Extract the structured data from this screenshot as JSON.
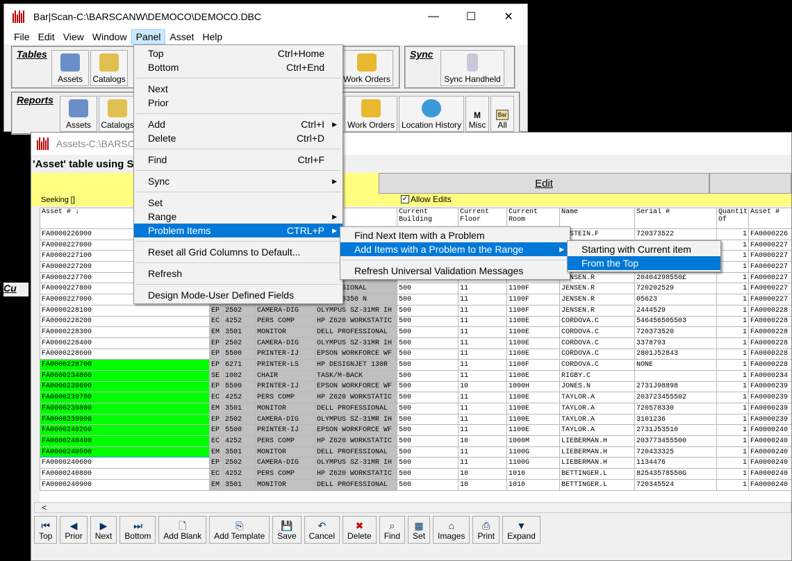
{
  "main_window": {
    "title": "Bar|Scan-C:\\BARSCANW\\DEMOCO\\DEMOCO.DBC",
    "controls": [
      "—",
      "☐",
      "✕"
    ],
    "menubar": [
      "File",
      "Edit",
      "View",
      "Window",
      "Panel",
      "Asset",
      "Help"
    ],
    "tables_group": {
      "label": "Tables",
      "buttons": [
        "Assets",
        "Catalogs",
        "Work Orders"
      ]
    },
    "sync_group": {
      "label": "Sync",
      "buttons": [
        "Sync Handheld"
      ]
    },
    "reports_group": {
      "label": "Reports",
      "buttons": [
        "Assets",
        "Catalogs",
        "Work Orders",
        "Location History",
        "Misc",
        "All"
      ]
    },
    "misc_letter": "M",
    "all_letters": "Bar",
    "cut_label": "Cu"
  },
  "assets_window": {
    "title": "Assets-C:\\BARSCAN",
    "subtitle": "'Asset' table using Se",
    "tab_edit": "Edit",
    "seeking_label": "Seeking []",
    "allow_edits_label": "Allow Edits",
    "columns": [
      "Asset #",
      "",
      "",
      "",
      "g\nation",
      "Current\nBuilding",
      "Current\nFloor",
      "Current\nRoom",
      "Name",
      "Serial #",
      "Quantit\nOf",
      "Asset #"
    ],
    "rows": [
      [
        "FA0000226900",
        "",
        "",
        "",
        "",
        "",
        "",
        "",
        "RNSTEIN.F",
        "720373522",
        "1",
        "FA0000226"
      ],
      [
        "FA0000227000",
        "",
        "",
        "",
        "",
        "",
        "",
        "",
        "",
        "",
        "1",
        "FA0000227"
      ],
      [
        "FA0000227100",
        "",
        "",
        "",
        "",
        "",
        "",
        "",
        "",
        "",
        "1",
        "FA0000227"
      ],
      [
        "FA0000227200",
        "",
        "",
        "",
        "",
        "",
        "",
        "",
        "",
        "",
        "1",
        "FA0000227"
      ],
      [
        "FA0000227700",
        "",
        "",
        "",
        "WORKSTATIC",
        "500",
        "11",
        "1100F",
        "JENSEN.R",
        "20404298550£",
        "1",
        "FA0000227"
      ],
      [
        "FA0000227800",
        "",
        "",
        "",
        "PROFESSIONAL",
        "500",
        "11",
        "1100F",
        "JENSEN.R",
        "720202529",
        "1",
        "FA0000227"
      ],
      [
        "FA0000227900",
        "",
        "",
        "",
        "NJET N6350 N",
        "500",
        "11",
        "1100F",
        "JENSEN.R",
        "05623",
        "1",
        "FA0000227"
      ],
      [
        "FA0000228100",
        "EP",
        "2502",
        "CAMERA-DIG",
        "OLYMPUS SZ-31MR IH",
        "500",
        "11",
        "1100F",
        "JENSEN.R",
        "2444529",
        "1",
        "FA0000228"
      ],
      [
        "FA0000228200",
        "EC",
        "4252",
        "PERS COMP",
        "HP Z620 WORKSTATIC",
        "500",
        "11",
        "1100E",
        "CORDOVA.C",
        "546456505503",
        "1",
        "FA0000228"
      ],
      [
        "FA0000228300",
        "EM",
        "3501",
        "MONITOR",
        "DELL PROFESSIONAL",
        "500",
        "11",
        "1100E",
        "CORDOVA.C",
        "720373520",
        "1",
        "FA0000228"
      ],
      [
        "FA0000228400",
        "EP",
        "2502",
        "CAMERA-DIG",
        "OLYMPUS SZ-31MR IH",
        "500",
        "11",
        "1100E",
        "CORDOVA.C",
        "3378793",
        "1",
        "FA0000228"
      ],
      [
        "FA0000228600",
        "EP",
        "5500",
        "PRINTER-IJ",
        "EPSON WORKFORCE WF",
        "500",
        "11",
        "1100E",
        "CORDOVA.C",
        "2801J52843",
        "1",
        "FA0000228"
      ],
      [
        "FA0000228700",
        "EP",
        "6271",
        "PRINTER-LS",
        "HP DESIGNJET 130R",
        "500",
        "11",
        "1100F",
        "CORDOVA.C",
        "NONE",
        "1",
        "FA0000228"
      ],
      [
        "FA0000234800",
        "SE",
        "1002",
        "CHAIR",
        "TASK/M-BACK",
        "500",
        "11",
        "1100E",
        "RIGBY.C",
        "",
        "1",
        "FA0000234"
      ],
      [
        "FA0000239600",
        "EP",
        "5500",
        "PRINTER-IJ",
        "EPSON WORKFORCE WF",
        "500",
        "10",
        "1000H",
        "JONES.N",
        "2731J98898",
        "1",
        "FA0000239"
      ],
      [
        "FA0000239700",
        "EC",
        "4252",
        "PERS COMP",
        "HP Z620 WORKSTATIC",
        "500",
        "11",
        "1100E",
        "TAYLOR.A",
        "203723455502",
        "1",
        "FA0000239"
      ],
      [
        "FA0000239800",
        "EM",
        "3501",
        "MONITOR",
        "DELL PROFESSIONAL",
        "500",
        "11",
        "1100E",
        "TAYLOR.A",
        "720578330",
        "1",
        "FA0000239"
      ],
      [
        "FA0000239900",
        "EP",
        "2502",
        "CAMERA-DIG",
        "OLYMPUS SZ-31MR IH",
        "500",
        "11",
        "1100E",
        "TAYLOR.A",
        "3101236",
        "1",
        "FA0000239"
      ],
      [
        "FA0000240200",
        "EP",
        "5500",
        "PRINTER-IJ",
        "EPSON WORKFORCE WF",
        "500",
        "11",
        "1100E",
        "TAYLOR.A",
        "2731J53510",
        "1",
        "FA0000240"
      ],
      [
        "FA0000240400",
        "EC",
        "4252",
        "PERS COMP",
        "HP Z620 WORKSTATIC",
        "500",
        "10",
        "1000M",
        "LIEBERMAN.H",
        "203773455500",
        "1",
        "FA0000240"
      ],
      [
        "FA0000240500",
        "EM",
        "3501",
        "MONITOR",
        "DELL PROFESSIONAL",
        "500",
        "11",
        "1100G",
        "LIEBERMAN.H",
        "720433325",
        "1",
        "FA0000240"
      ],
      [
        "FA0000240600",
        "EP",
        "2502",
        "CAMERA-DIG",
        "OLYMPUS SZ-31MR IH",
        "500",
        "11",
        "1100G",
        "LIEBERMAN.H",
        "1134476",
        "1",
        "FA0000240"
      ],
      [
        "FA0000240800",
        "EC",
        "4252",
        "PERS COMP",
        "HP Z620 WORKSTATIC",
        "500",
        "10",
        "1010",
        "BETTINGER.L",
        "82543578550G",
        "1",
        "FA0000240"
      ],
      [
        "FA0000240900",
        "EM",
        "3501",
        "MONITOR",
        "DELL PROFESSIONAL",
        "500",
        "10",
        "1010",
        "BETTINGER.L",
        "720345524",
        "1",
        "FA0000240"
      ]
    ],
    "green_rows": [
      12,
      13,
      14,
      15,
      16,
      17,
      18,
      19,
      20
    ],
    "current_row": 20,
    "scroll_left": "<",
    "buttons": [
      "Top",
      "Prior",
      "Next",
      "Bottom",
      "Add Blank",
      "Add Template",
      "Save",
      "Cancel",
      "Delete",
      "Find",
      "Set",
      "Images",
      "Print",
      "Expand"
    ]
  },
  "panel_menu": {
    "items": [
      {
        "label": "Top",
        "shortcut": "Ctrl+Home"
      },
      {
        "label": "Bottom",
        "shortcut": "Ctrl+End"
      },
      {
        "sep": true
      },
      {
        "label": "Next",
        "shortcut": ""
      },
      {
        "label": "Prior",
        "shortcut": ""
      },
      {
        "sep": true
      },
      {
        "label": "Add",
        "shortcut": "Ctrl+I",
        "sub": true
      },
      {
        "label": "Delete",
        "shortcut": "Ctrl+D"
      },
      {
        "sep": true
      },
      {
        "label": "Find",
        "shortcut": "Ctrl+F"
      },
      {
        "sep": true
      },
      {
        "label": "Sync",
        "shortcut": "",
        "sub": true
      },
      {
        "sep": true
      },
      {
        "label": "Set",
        "shortcut": ""
      },
      {
        "label": "Range",
        "shortcut": "",
        "sub": true
      },
      {
        "label": "Problem Items",
        "shortcut": "CTRL+P",
        "sub": true,
        "hl": true
      },
      {
        "sep": true
      },
      {
        "label": "Reset all Grid Columns to Default...",
        "shortcut": ""
      },
      {
        "sep": true
      },
      {
        "label": "Refresh",
        "shortcut": ""
      },
      {
        "sep": true
      },
      {
        "label": "Design Mode-User Defined Fields",
        "shortcut": ""
      }
    ]
  },
  "problem_menu": {
    "items": [
      {
        "label": "Find Next Item with a Problem"
      },
      {
        "label": "Add Items with a Problem to the Range",
        "sub": true,
        "hl": true
      },
      {
        "sep": true
      },
      {
        "label": "Refresh Universal Validation Messages"
      }
    ]
  },
  "range_menu": {
    "items": [
      {
        "label": "Starting with Current item"
      },
      {
        "label": "From the Top",
        "hl": true
      }
    ]
  }
}
